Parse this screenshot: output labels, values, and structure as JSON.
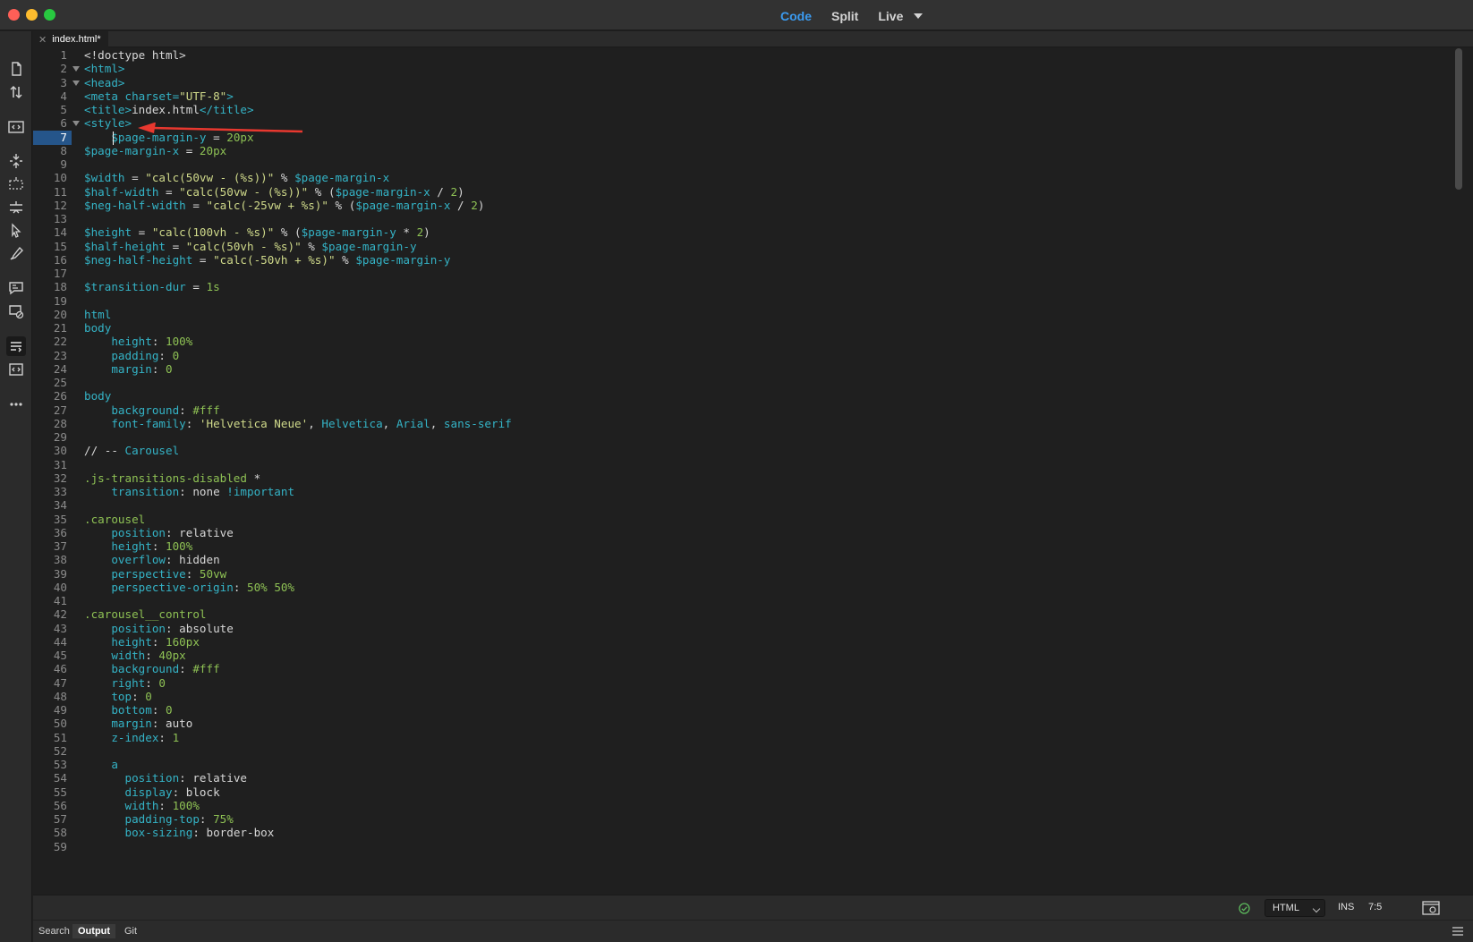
{
  "window": {
    "views": [
      {
        "label": "Code",
        "active": true
      },
      {
        "label": "Split",
        "active": false
      },
      {
        "label": "Live",
        "active": false
      }
    ]
  },
  "toolbar": {
    "tools": [
      "file-icon",
      "file-transfer-icon",
      "code-navigator-icon",
      "expand-icon",
      "select-region-icon",
      "move-icon",
      "pointer-icon",
      "eyedropper-icon",
      "comment-icon",
      "remove-comment-icon",
      "wrap-tag-icon",
      "format-source-icon",
      "more-icon"
    ]
  },
  "tab": {
    "filename": "index.html*"
  },
  "editor": {
    "active_line": 7,
    "lines": [
      {
        "n": "1",
        "fold": false,
        "segs": [
          [
            "<!doctype html>",
            "plain"
          ]
        ]
      },
      {
        "n": "2",
        "fold": true,
        "segs": [
          [
            "<html>",
            "tag"
          ]
        ]
      },
      {
        "n": "3",
        "fold": true,
        "segs": [
          [
            "<head>",
            "tag"
          ]
        ]
      },
      {
        "n": "4",
        "fold": false,
        "segs": [
          [
            "<meta charset=",
            "tag"
          ],
          [
            "\"UTF-8\"",
            "str"
          ],
          [
            ">",
            "tag"
          ]
        ]
      },
      {
        "n": "5",
        "fold": false,
        "segs": [
          [
            "<title>",
            "tag"
          ],
          [
            "index.html",
            "plain"
          ],
          [
            "</title>",
            "tag"
          ]
        ]
      },
      {
        "n": "6",
        "fold": true,
        "segs": [
          [
            "<style>",
            "tag"
          ]
        ]
      },
      {
        "n": "7",
        "fold": false,
        "segs": [
          [
            "    $page-margin-y",
            "var"
          ],
          [
            " = ",
            "plain"
          ],
          [
            "20px",
            "num"
          ]
        ]
      },
      {
        "n": "8",
        "fold": false,
        "segs": [
          [
            "$page-margin-x",
            "var"
          ],
          [
            " = ",
            "plain"
          ],
          [
            "20px",
            "num"
          ]
        ]
      },
      {
        "n": "9",
        "fold": false,
        "segs": []
      },
      {
        "n": "10",
        "fold": false,
        "segs": [
          [
            "$width",
            "var"
          ],
          [
            " = ",
            "plain"
          ],
          [
            "\"calc(50vw - (%s))\"",
            "str"
          ],
          [
            " % ",
            "plain"
          ],
          [
            "$page-margin-x",
            "var"
          ]
        ]
      },
      {
        "n": "11",
        "fold": false,
        "segs": [
          [
            "$half-width",
            "var"
          ],
          [
            " = ",
            "plain"
          ],
          [
            "\"calc(50vw - (%s))\"",
            "str"
          ],
          [
            " % (",
            "plain"
          ],
          [
            "$page-margin-x",
            "var"
          ],
          [
            " / ",
            "plain"
          ],
          [
            "2",
            "num"
          ],
          [
            ")",
            "plain"
          ]
        ]
      },
      {
        "n": "12",
        "fold": false,
        "segs": [
          [
            "$neg-half-width",
            "var"
          ],
          [
            " = ",
            "plain"
          ],
          [
            "\"calc(-25vw + %s)\"",
            "str"
          ],
          [
            " % (",
            "plain"
          ],
          [
            "$page-margin-x",
            "var"
          ],
          [
            " / ",
            "plain"
          ],
          [
            "2",
            "num"
          ],
          [
            ")",
            "plain"
          ]
        ]
      },
      {
        "n": "13",
        "fold": false,
        "segs": []
      },
      {
        "n": "14",
        "fold": false,
        "segs": [
          [
            "$height",
            "var"
          ],
          [
            " = ",
            "plain"
          ],
          [
            "\"calc(100vh - %s)\"",
            "str"
          ],
          [
            " % (",
            "plain"
          ],
          [
            "$page-margin-y",
            "var"
          ],
          [
            " * ",
            "plain"
          ],
          [
            "2",
            "num"
          ],
          [
            ")",
            "plain"
          ]
        ]
      },
      {
        "n": "15",
        "fold": false,
        "segs": [
          [
            "$half-height",
            "var"
          ],
          [
            " = ",
            "plain"
          ],
          [
            "\"calc(50vh - %s)\"",
            "str"
          ],
          [
            " % ",
            "plain"
          ],
          [
            "$page-margin-y",
            "var"
          ]
        ]
      },
      {
        "n": "16",
        "fold": false,
        "segs": [
          [
            "$neg-half-height",
            "var"
          ],
          [
            " = ",
            "plain"
          ],
          [
            "\"calc(-50vh + %s)\"",
            "str"
          ],
          [
            " % ",
            "plain"
          ],
          [
            "$page-margin-y",
            "var"
          ]
        ]
      },
      {
        "n": "17",
        "fold": false,
        "segs": []
      },
      {
        "n": "18",
        "fold": false,
        "segs": [
          [
            "$transition-dur",
            "var"
          ],
          [
            " = ",
            "plain"
          ],
          [
            "1s",
            "num"
          ]
        ]
      },
      {
        "n": "19",
        "fold": false,
        "segs": []
      },
      {
        "n": "20",
        "fold": false,
        "segs": [
          [
            "html",
            "kw"
          ]
        ]
      },
      {
        "n": "21",
        "fold": false,
        "segs": [
          [
            "body",
            "kw"
          ]
        ]
      },
      {
        "n": "22",
        "fold": false,
        "segs": [
          [
            "    height",
            "prop"
          ],
          [
            ": ",
            "plain"
          ],
          [
            "100%",
            "num"
          ]
        ]
      },
      {
        "n": "23",
        "fold": false,
        "segs": [
          [
            "    padding",
            "prop"
          ],
          [
            ": ",
            "plain"
          ],
          [
            "0",
            "num"
          ]
        ]
      },
      {
        "n": "24",
        "fold": false,
        "segs": [
          [
            "    margin",
            "prop"
          ],
          [
            ": ",
            "plain"
          ],
          [
            "0",
            "num"
          ]
        ]
      },
      {
        "n": "25",
        "fold": false,
        "segs": []
      },
      {
        "n": "26",
        "fold": false,
        "segs": [
          [
            "body",
            "kw"
          ]
        ]
      },
      {
        "n": "27",
        "fold": false,
        "segs": [
          [
            "    background",
            "prop"
          ],
          [
            ": ",
            "plain"
          ],
          [
            "#fff",
            "num"
          ]
        ]
      },
      {
        "n": "28",
        "fold": false,
        "segs": [
          [
            "    font-family",
            "prop"
          ],
          [
            ": ",
            "plain"
          ],
          [
            "'Helvetica Neue'",
            "str"
          ],
          [
            ", ",
            "plain"
          ],
          [
            "Helvetica",
            "kw"
          ],
          [
            ", ",
            "plain"
          ],
          [
            "Arial",
            "kw"
          ],
          [
            ", ",
            "plain"
          ],
          [
            "sans-serif",
            "kw"
          ]
        ]
      },
      {
        "n": "29",
        "fold": false,
        "segs": []
      },
      {
        "n": "30",
        "fold": false,
        "segs": [
          [
            "// -- ",
            "cmt"
          ],
          [
            "Carousel",
            "kw"
          ]
        ]
      },
      {
        "n": "31",
        "fold": false,
        "segs": []
      },
      {
        "n": "32",
        "fold": false,
        "segs": [
          [
            ".js-transitions-disabled",
            "sel"
          ],
          [
            " *",
            "plain"
          ]
        ]
      },
      {
        "n": "33",
        "fold": false,
        "segs": [
          [
            "    transition",
            "prop"
          ],
          [
            ": none ",
            "plain"
          ],
          [
            "!important",
            "kw"
          ]
        ]
      },
      {
        "n": "34",
        "fold": false,
        "segs": []
      },
      {
        "n": "35",
        "fold": false,
        "segs": [
          [
            ".carousel",
            "sel"
          ]
        ]
      },
      {
        "n": "36",
        "fold": false,
        "segs": [
          [
            "    position",
            "prop"
          ],
          [
            ": relative",
            "plain"
          ]
        ]
      },
      {
        "n": "37",
        "fold": false,
        "segs": [
          [
            "    height",
            "prop"
          ],
          [
            ": ",
            "plain"
          ],
          [
            "100%",
            "num"
          ]
        ]
      },
      {
        "n": "38",
        "fold": false,
        "segs": [
          [
            "    overflow",
            "prop"
          ],
          [
            ": hidden",
            "plain"
          ]
        ]
      },
      {
        "n": "39",
        "fold": false,
        "segs": [
          [
            "    perspective",
            "prop"
          ],
          [
            ": ",
            "plain"
          ],
          [
            "50vw",
            "num"
          ]
        ]
      },
      {
        "n": "40",
        "fold": false,
        "segs": [
          [
            "    perspective-origin",
            "prop"
          ],
          [
            ": ",
            "plain"
          ],
          [
            "50% 50%",
            "num"
          ]
        ]
      },
      {
        "n": "41",
        "fold": false,
        "segs": []
      },
      {
        "n": "42",
        "fold": false,
        "segs": [
          [
            ".carousel__control",
            "sel"
          ]
        ]
      },
      {
        "n": "43",
        "fold": false,
        "segs": [
          [
            "    position",
            "prop"
          ],
          [
            ": absolute",
            "plain"
          ]
        ]
      },
      {
        "n": "44",
        "fold": false,
        "segs": [
          [
            "    height",
            "prop"
          ],
          [
            ": ",
            "plain"
          ],
          [
            "160px",
            "num"
          ]
        ]
      },
      {
        "n": "45",
        "fold": false,
        "segs": [
          [
            "    width",
            "prop"
          ],
          [
            ": ",
            "plain"
          ],
          [
            "40px",
            "num"
          ]
        ]
      },
      {
        "n": "46",
        "fold": false,
        "segs": [
          [
            "    background",
            "prop"
          ],
          [
            ": ",
            "plain"
          ],
          [
            "#fff",
            "num"
          ]
        ]
      },
      {
        "n": "47",
        "fold": false,
        "segs": [
          [
            "    right",
            "prop"
          ],
          [
            ": ",
            "plain"
          ],
          [
            "0",
            "num"
          ]
        ]
      },
      {
        "n": "48",
        "fold": false,
        "segs": [
          [
            "    top",
            "prop"
          ],
          [
            ": ",
            "plain"
          ],
          [
            "0",
            "num"
          ]
        ]
      },
      {
        "n": "49",
        "fold": false,
        "segs": [
          [
            "    bottom",
            "prop"
          ],
          [
            ": ",
            "plain"
          ],
          [
            "0",
            "num"
          ]
        ]
      },
      {
        "n": "50",
        "fold": false,
        "segs": [
          [
            "    margin",
            "prop"
          ],
          [
            ": auto",
            "plain"
          ]
        ]
      },
      {
        "n": "51",
        "fold": false,
        "segs": [
          [
            "    z-index",
            "prop"
          ],
          [
            ": ",
            "plain"
          ],
          [
            "1",
            "num"
          ]
        ]
      },
      {
        "n": "52",
        "fold": false,
        "segs": []
      },
      {
        "n": "53",
        "fold": false,
        "segs": [
          [
            "    a",
            "kw"
          ]
        ]
      },
      {
        "n": "54",
        "fold": false,
        "segs": [
          [
            "      position",
            "prop"
          ],
          [
            ": relative",
            "plain"
          ]
        ]
      },
      {
        "n": "55",
        "fold": false,
        "segs": [
          [
            "      display",
            "prop"
          ],
          [
            ": block",
            "plain"
          ]
        ]
      },
      {
        "n": "56",
        "fold": false,
        "segs": [
          [
            "      width",
            "prop"
          ],
          [
            ": ",
            "plain"
          ],
          [
            "100%",
            "num"
          ]
        ]
      },
      {
        "n": "57",
        "fold": false,
        "segs": [
          [
            "      padding-top",
            "prop"
          ],
          [
            ": ",
            "plain"
          ],
          [
            "75%",
            "num"
          ]
        ]
      },
      {
        "n": "58",
        "fold": false,
        "segs": [
          [
            "      box-sizing",
            "prop"
          ],
          [
            ": border-box",
            "plain"
          ]
        ]
      },
      {
        "n": "59",
        "fold": false,
        "segs": []
      }
    ]
  },
  "statusbar": {
    "language": "HTML",
    "mode": "INS",
    "cursor": "7:5"
  },
  "bottom_tabs": [
    {
      "label": "Search",
      "active": false
    },
    {
      "label": "Output",
      "active": true
    },
    {
      "label": "Git",
      "active": false
    }
  ],
  "colors": {
    "accent": "#3b9bf0",
    "tag": "#34b3c6",
    "string": "#cfd98a",
    "number": "#8ec154",
    "annotation_arrow": "#e8382f"
  }
}
